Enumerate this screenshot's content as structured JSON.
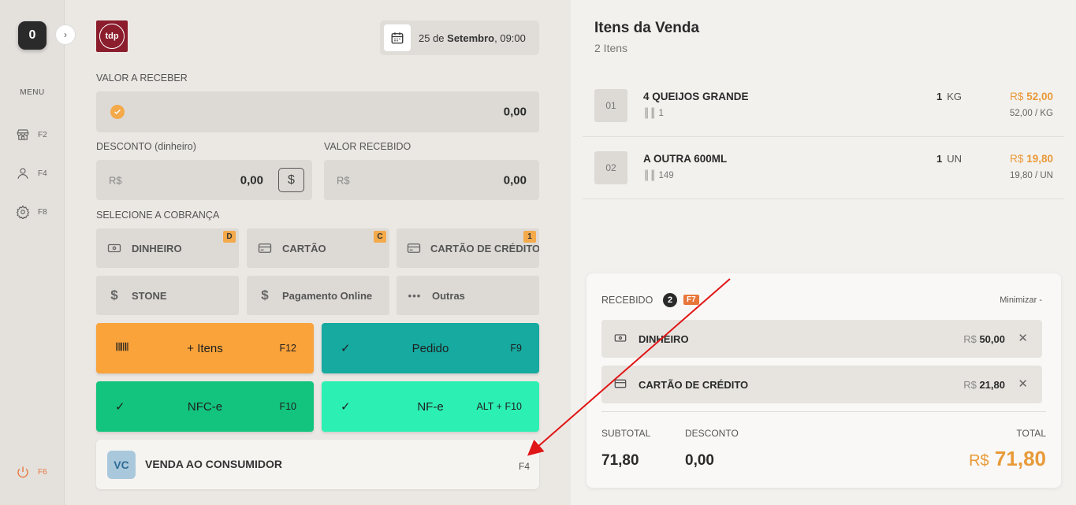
{
  "sidebar": {
    "counter": "0",
    "menu_label": "MENU",
    "items": [
      {
        "icon": "store-icon",
        "key": "F2"
      },
      {
        "icon": "user-icon",
        "key": "F4"
      },
      {
        "icon": "gear-icon",
        "key": "F8"
      }
    ],
    "power_key": "F6"
  },
  "header": {
    "logo_text": "tdp",
    "date_day": "25 de ",
    "date_month": "Setembro",
    "date_time": ", 09:00"
  },
  "payment": {
    "amount_due_label": "VALOR A RECEBER",
    "amount_due_value": "0,00",
    "discount_label": "DESCONTO (dinheiro)",
    "discount_currency": "R$",
    "discount_value": "0,00",
    "received_label": "VALOR RECEBIDO",
    "received_currency": "R$",
    "received_value": "0,00",
    "select_label": "SELECIONE A COBRANÇA",
    "methods": [
      {
        "label": "DINHEIRO",
        "key": "D",
        "icon": "cash-icon"
      },
      {
        "label": "CARTÃO",
        "key": "C",
        "icon": "card-icon"
      },
      {
        "label": "CARTÃO DE CRÉDITO",
        "key": "1",
        "icon": "card-icon"
      },
      {
        "label": "STONE",
        "key": "",
        "icon": "dollar-icon"
      },
      {
        "label": "Pagamento Online",
        "key": "",
        "icon": "dollar-icon"
      },
      {
        "label": "Outras",
        "key": "",
        "icon": "more-icon"
      }
    ]
  },
  "actions": [
    {
      "label": "+ Itens",
      "key": "F12",
      "color": "#f9a33a"
    },
    {
      "label": "Pedido",
      "key": "F9",
      "color": "#16aaa0"
    },
    {
      "label": "NFC-e",
      "key": "F10",
      "color": "#13c47e"
    },
    {
      "label": "NF-e",
      "key": "ALT + F10",
      "color": "#2cf0b3"
    }
  ],
  "consumer": {
    "initials": "VC",
    "name": "VENDA AO CONSUMIDOR",
    "key": "F4"
  },
  "sale": {
    "title": "Itens da Venda",
    "count": "2 Itens",
    "items": [
      {
        "num": "01",
        "name": "4 QUEIJOS GRANDE",
        "code": "1",
        "qty": "1",
        "unit": "KG",
        "currency": "R$",
        "price": "52,00",
        "unit_price": "52,00 / KG"
      },
      {
        "num": "02",
        "name": "A OUTRA 600ML",
        "code": "149",
        "qty": "1",
        "unit": "UN",
        "currency": "R$",
        "price": "19,80",
        "unit_price": "19,80 / UN"
      }
    ]
  },
  "received": {
    "label": "RECEBIDO",
    "count": "2",
    "key": "F7",
    "minimize": "Minimizar -",
    "entries": [
      {
        "name": "DINHEIRO",
        "currency": "R$",
        "amount": "50,00",
        "icon": "cash-icon"
      },
      {
        "name": "CARTÃO DE CRÉDITO",
        "currency": "R$",
        "amount": "21,80",
        "icon": "card-icon"
      }
    ],
    "subtotal_label": "SUBTOTAL",
    "subtotal_value": "71,80",
    "discount_label": "DESCONTO",
    "discount_value": "0,00",
    "total_label": "TOTAL",
    "total_currency": "R$",
    "total_value": "71,80"
  }
}
